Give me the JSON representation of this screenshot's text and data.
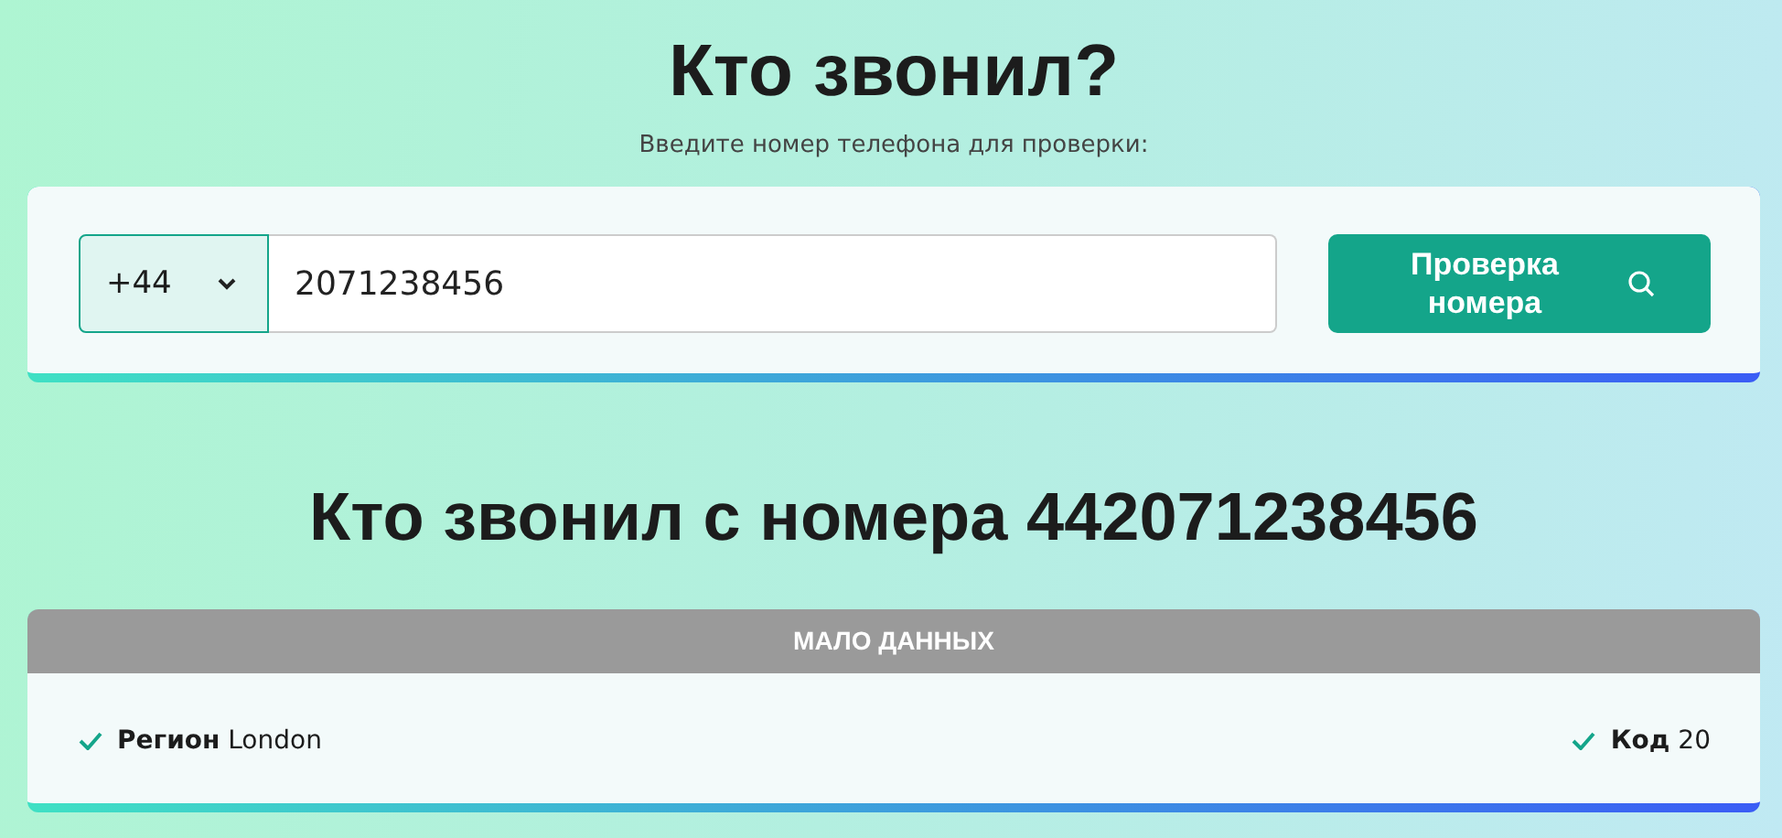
{
  "header": {
    "title": "Кто звонил?",
    "subtitle": "Введите номер телефона для проверки:"
  },
  "search": {
    "country_code": "+44",
    "phone_value": "2071238456",
    "button_label": "Проверка номера"
  },
  "result": {
    "title": "Кто звонил с номера 442071238456",
    "status": "МАЛО ДАННЫХ",
    "facts": [
      {
        "text": "**Регион** London"
      },
      {
        "text": "**Код** 20"
      }
    ]
  }
}
